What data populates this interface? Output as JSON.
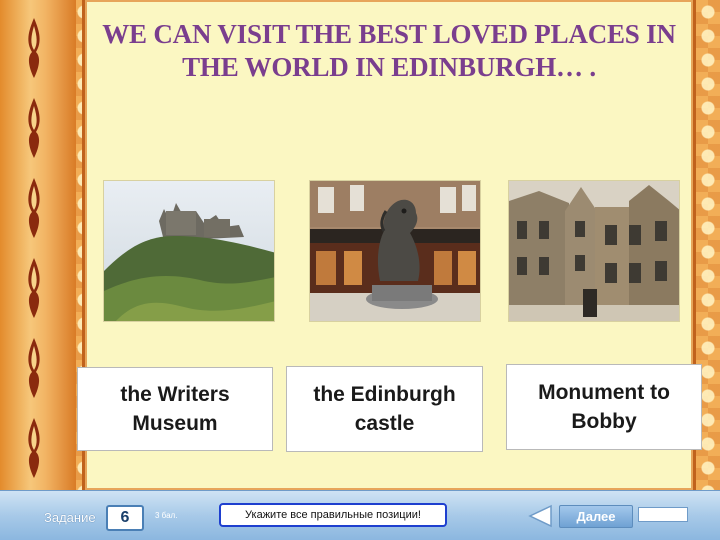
{
  "slide": {
    "title": "WE CAN VISIT THE BEST LOVED PLACES IN THE WORLD IN EDINBURGH… ."
  },
  "photos": [
    {
      "name": "castle-photo",
      "icon": "castle-on-hill-image"
    },
    {
      "name": "bobby-statue-photo",
      "icon": "dog-statue-image"
    },
    {
      "name": "writers-museum-photo",
      "icon": "old-stone-building-image"
    }
  ],
  "cards": [
    {
      "label": "the Writers\nMuseum"
    },
    {
      "label": "the Edinburgh\ncastle"
    },
    {
      "label": "Monument to\nBobby"
    }
  ],
  "toolbar": {
    "task_label": "Задание",
    "task_number": "6",
    "points": "3 бал.",
    "hint": "Укажите все правильные позиции!",
    "back_icon": "triangle-left-icon",
    "next_label": "Далее"
  },
  "colors": {
    "title": "#7a3e8e",
    "panel": "#fbf7c2",
    "frame": "#f2ae57",
    "toolbar": "#a7c9e8",
    "hint_border": "#1e3fcf"
  }
}
